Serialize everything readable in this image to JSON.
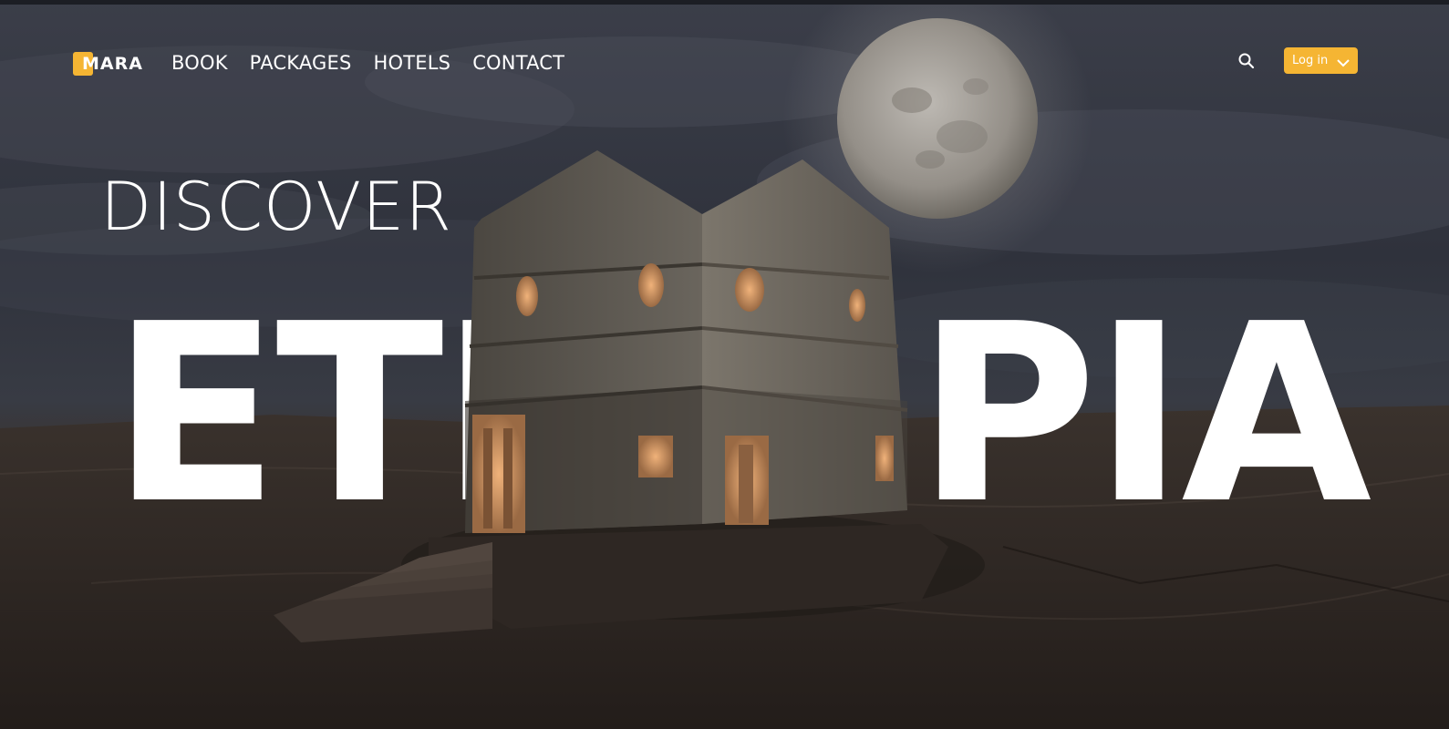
{
  "brand": {
    "name": "MARA",
    "accent": "#f5b533"
  },
  "nav": {
    "links": [
      "BOOK",
      "PACKAGES",
      "HOTELS",
      "CONTACT"
    ],
    "search_icon": "search-icon",
    "login_label": "Log in",
    "login_icon": "chevron-down-icon"
  },
  "hero": {
    "kicker": "DISCOVER",
    "headline_left": "ETH",
    "headline_right": "PIA",
    "background": "stormy night sky with full moon over rock-hewn church"
  }
}
